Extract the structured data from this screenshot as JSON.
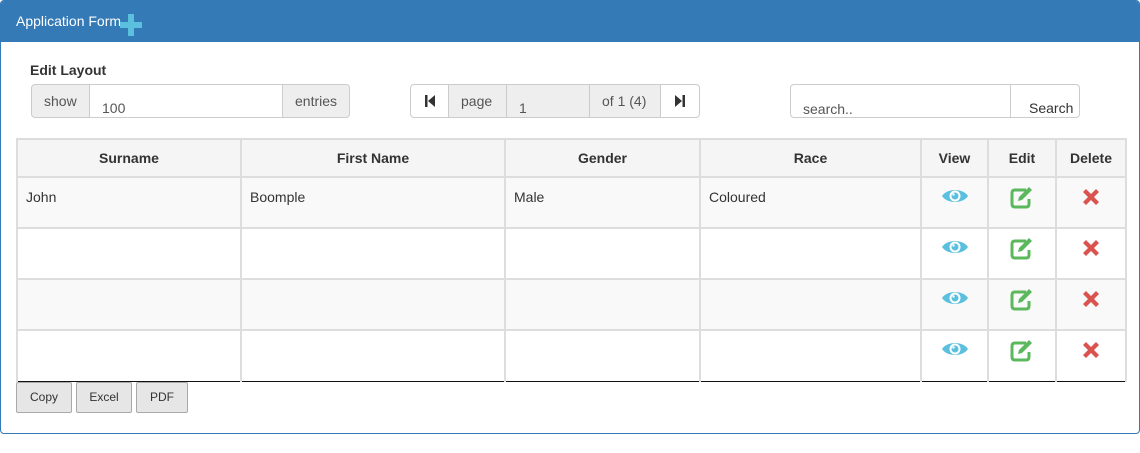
{
  "header": {
    "title": "Application Form"
  },
  "layout": {
    "label": "Edit Layout"
  },
  "length_control": {
    "show_label": "show",
    "value": "100",
    "entries_label": "entries"
  },
  "pager": {
    "page_label": "page",
    "page_value": "1",
    "of_label": "of 1 (4)"
  },
  "search": {
    "placeholder": "search..",
    "button_label": "Search"
  },
  "table": {
    "columns": [
      "Surname",
      "First Name",
      "Gender",
      "Race",
      "View",
      "Edit",
      "Delete"
    ],
    "rows": [
      {
        "surname": "John",
        "first_name": "Boomple",
        "gender": "Male",
        "race": "Coloured"
      },
      {
        "surname": "",
        "first_name": "",
        "gender": "",
        "race": ""
      },
      {
        "surname": "",
        "first_name": "",
        "gender": "",
        "race": ""
      },
      {
        "surname": "",
        "first_name": "",
        "gender": "",
        "race": ""
      }
    ]
  },
  "export_buttons": {
    "copy": "Copy",
    "excel": "Excel",
    "pdf": "PDF"
  },
  "icons": {
    "add": "plus-icon",
    "first_page": "first-page-icon",
    "last_page": "last-page-icon",
    "view": "eye-icon",
    "edit": "edit-icon",
    "delete": "close-icon"
  },
  "colors": {
    "header_bg": "#337ab7",
    "plus": "#5bc0de",
    "view": "#5bc0de",
    "edit": "#5cb85c",
    "delete": "#d9534f"
  }
}
